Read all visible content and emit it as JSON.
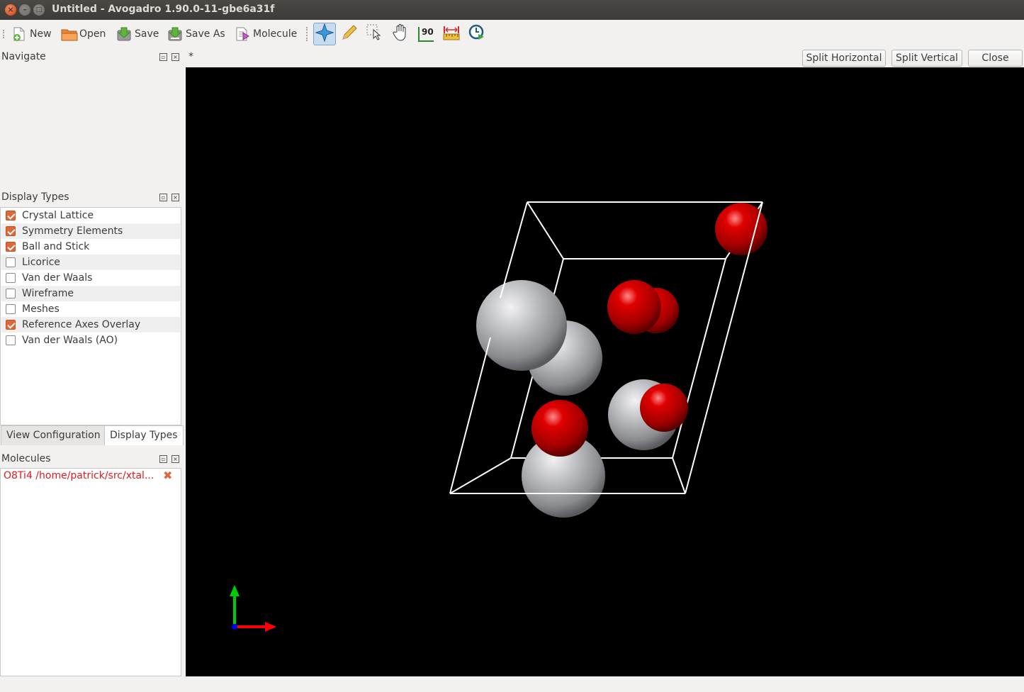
{
  "window": {
    "title": "Untitled - Avogadro 1.90.0-11-gbe6a31f",
    "close_glyph": "×",
    "min_glyph": "–",
    "max_glyph": "□"
  },
  "toolbar": {
    "new_label": "New",
    "open_label": "Open",
    "save_label": "Save",
    "save_as_label": "Save As",
    "molecule_label": "Molecule",
    "tools": [
      {
        "name": "navigate-tool-icon",
        "active": true
      },
      {
        "name": "draw-tool-icon",
        "active": false
      },
      {
        "name": "select-tool-icon",
        "active": false
      },
      {
        "name": "manipulate-tool-icon",
        "active": false
      },
      {
        "name": "bond-centric-tool-icon",
        "label": "90",
        "active": false
      },
      {
        "name": "measure-tool-icon",
        "active": false
      },
      {
        "name": "playback-tool-icon",
        "active": false
      }
    ]
  },
  "navigate_dock": {
    "title": "Navigate"
  },
  "display_types_dock": {
    "title": "Display Types",
    "items": [
      {
        "label": "Crystal Lattice",
        "checked": true
      },
      {
        "label": "Symmetry Elements",
        "checked": true
      },
      {
        "label": "Ball and Stick",
        "checked": true
      },
      {
        "label": "Licorice",
        "checked": false
      },
      {
        "label": "Van der Waals",
        "checked": false
      },
      {
        "label": "Wireframe",
        "checked": false
      },
      {
        "label": "Meshes",
        "checked": false
      },
      {
        "label": "Reference Axes Overlay",
        "checked": true
      },
      {
        "label": "Van der Waals (AO)",
        "checked": false
      }
    ],
    "tabs": {
      "view_configuration": "View Configuration",
      "display_types": "Display Types"
    }
  },
  "molecules_dock": {
    "title": "Molecules",
    "items": [
      {
        "label": "O8Ti4 /home/patrick/src/xtal..."
      }
    ],
    "remove_glyph": "✖"
  },
  "view": {
    "tab_label": "*",
    "split_horizontal_label": "Split Horizontal",
    "split_vertical_label": "Split Vertical",
    "close_label": "Close"
  },
  "dock_controls": {
    "float_glyph": "▫",
    "close_glyph": "×"
  },
  "colors": {
    "accent": "#e0673a",
    "oxygen": "#d40000",
    "titanium": "#c0c1c4",
    "viewport_bg": "#000000",
    "axis_x": "#ff0000",
    "axis_y": "#00cc00",
    "axis_z": "#0000ff"
  }
}
